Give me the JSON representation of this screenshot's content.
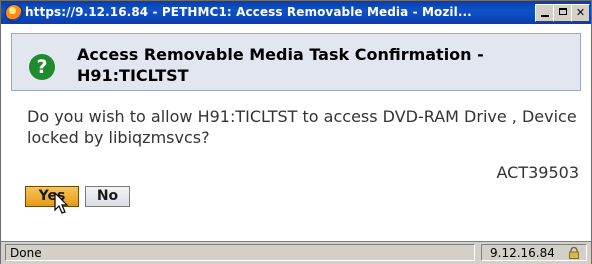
{
  "window": {
    "title": "https://9.12.16.84 - PETHMC1: Access Removable Media - Mozil...",
    "buttons": {
      "minimize": "",
      "maximize": "",
      "close": "✕"
    }
  },
  "dialog": {
    "title": "Access Removable Media Task Confirmation - H91:TICLTST",
    "icon": "question-icon",
    "icon_glyph": "?",
    "message": "Do you wish to allow H91:TICLTST to access DVD-RAM Drive , Device locked by libiqzmsvcs?",
    "code": "ACT39503",
    "yes_label": "Yes",
    "no_label": "No"
  },
  "statusbar": {
    "status": "Done",
    "host": "9.12.16.84",
    "lock_icon": "padlock-icon"
  },
  "colors": {
    "titlebar": "#0f52c9",
    "header_bg": "#e2e6ef",
    "question_icon": "#1f8a2e",
    "yes_button": "#e79a12"
  }
}
